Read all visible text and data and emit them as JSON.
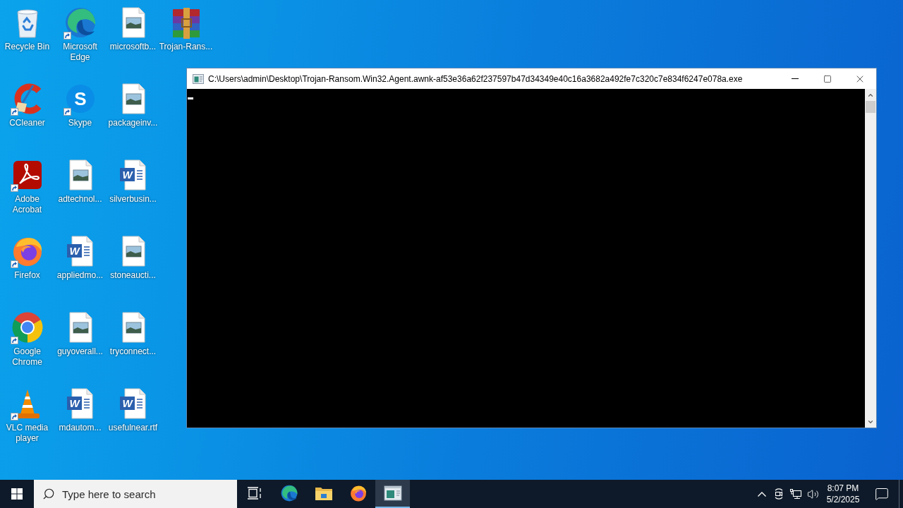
{
  "desktop": {
    "icon_rows": [
      [
        {
          "label": "Recycle Bin",
          "kind": "recycle-bin",
          "shortcut": false
        },
        {
          "label": "Microsoft Edge",
          "kind": "edge",
          "shortcut": true
        },
        {
          "label": "microsoftb...",
          "kind": "image-file",
          "shortcut": false
        },
        {
          "label": "Trojan-Rans...",
          "kind": "archive",
          "shortcut": false
        }
      ],
      [
        {
          "label": "CCleaner",
          "kind": "ccleaner",
          "shortcut": true
        },
        {
          "label": "Skype",
          "kind": "skype",
          "shortcut": true,
          "logo_text": "S"
        },
        {
          "label": "packageinv...",
          "kind": "image-file",
          "shortcut": false
        }
      ],
      [
        {
          "label": "Adobe Acrobat",
          "kind": "acrobat",
          "shortcut": true
        },
        {
          "label": "adtechnol...",
          "kind": "image-file",
          "shortcut": false
        },
        {
          "label": "silverbusin...",
          "kind": "word-file",
          "shortcut": false,
          "logo_text": "W"
        }
      ],
      [
        {
          "label": "Firefox",
          "kind": "firefox",
          "shortcut": true
        },
        {
          "label": "appliedmo...",
          "kind": "word-file",
          "shortcut": false,
          "logo_text": "W"
        },
        {
          "label": "stoneaucti...",
          "kind": "image-file",
          "shortcut": false
        }
      ],
      [
        {
          "label": "Google Chrome",
          "kind": "chrome",
          "shortcut": true
        },
        {
          "label": "guyoverall...",
          "kind": "image-file",
          "shortcut": false
        },
        {
          "label": "tryconnect...",
          "kind": "image-file",
          "shortcut": false
        }
      ],
      [
        {
          "label": "VLC media player",
          "kind": "vlc",
          "shortcut": true
        },
        {
          "label": "mdautom...",
          "kind": "word-file",
          "shortcut": false,
          "logo_text": "W"
        },
        {
          "label": "usefulnear.rtf",
          "kind": "word-file",
          "shortcut": false,
          "logo_text": "W"
        }
      ]
    ]
  },
  "window": {
    "title": "C:\\Users\\admin\\Desktop\\Trojan-Ransom.Win32.Agent.awnk-af53e36a62f237597b47d34349e40c16a3682a492fe7c320c7e834f6247e078a.exe",
    "cursor_visible": true
  },
  "taskbar": {
    "search": {
      "placeholder": "Type here to search"
    },
    "apps": [
      {
        "kind": "task-view",
        "active": false
      },
      {
        "kind": "edge",
        "active": false
      },
      {
        "kind": "file-explorer",
        "active": false
      },
      {
        "kind": "firefox",
        "active": false
      },
      {
        "kind": "console",
        "active": true
      }
    ],
    "tray_icons": [
      {
        "kind": "chevron"
      },
      {
        "kind": "meet-now"
      },
      {
        "kind": "network"
      },
      {
        "kind": "volume"
      }
    ],
    "clock": {
      "time": "8:07 PM",
      "date": "5/2/2025"
    }
  }
}
